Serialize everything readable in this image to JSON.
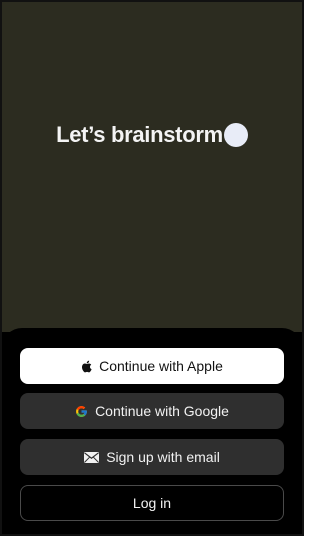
{
  "hero": {
    "tagline": "Let’s brainstorm"
  },
  "auth": {
    "apple": {
      "label": "Continue with Apple",
      "icon": "apple-icon"
    },
    "google": {
      "label": "Continue with Google",
      "icon": "google-icon"
    },
    "email": {
      "label": "Sign up with email",
      "icon": "mail-icon"
    },
    "login": {
      "label": "Log in"
    }
  },
  "colors": {
    "hero_background": "#2c2c20",
    "sheet_background": "#000000",
    "primary_button": "#ffffff",
    "secondary_button": "#2f2f2f"
  }
}
